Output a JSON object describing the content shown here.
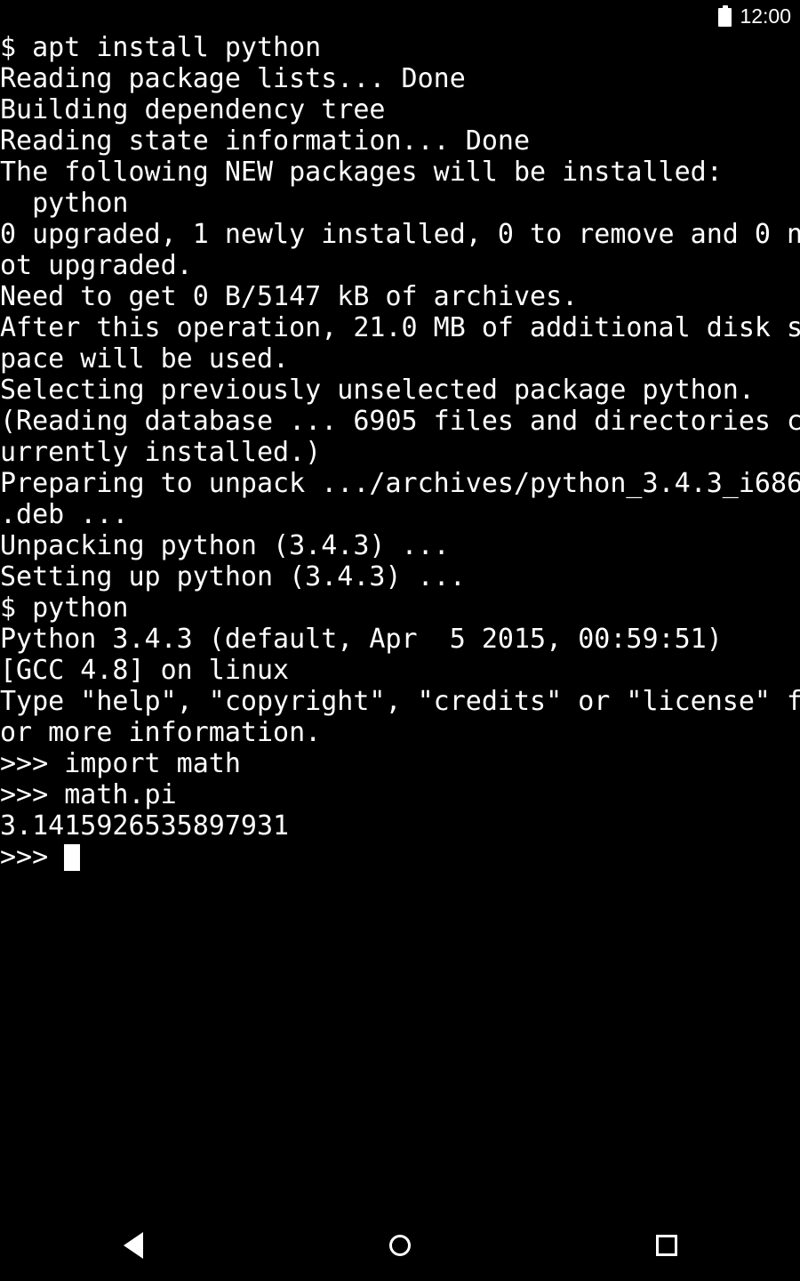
{
  "status_bar": {
    "battery_icon": "battery-full-icon",
    "time": "12:00"
  },
  "terminal": {
    "columns": 50,
    "foreground_color": "#ffffff",
    "background_color": "#000000",
    "cursor": "block",
    "lines": [
      "$ apt install python",
      "Reading package lists... Done",
      "Building dependency tree",
      "Reading state information... Done",
      "The following NEW packages will be installed:",
      "  python",
      "0 upgraded, 1 newly installed, 0 to remove and 0 n",
      "ot upgraded.",
      "Need to get 0 B/5147 kB of archives.",
      "After this operation, 21.0 MB of additional disk s",
      "pace will be used.",
      "Selecting previously unselected package python.",
      "(Reading database ... 6905 files and directories c",
      "urrently installed.)",
      "Preparing to unpack .../archives/python_3.4.3_i686",
      ".deb ...",
      "Unpacking python (3.4.3) ...",
      "Setting up python (3.4.3) ...",
      "$ python",
      "Python 3.4.3 (default, Apr  5 2015, 00:59:51)",
      "[GCC 4.8] on linux",
      "Type \"help\", \"copyright\", \"credits\" or \"license\" f",
      "or more information.",
      ">>> import math",
      ">>> math.pi",
      "3.1415926535897931"
    ],
    "prompt_line": ">>> "
  },
  "nav_bar": {
    "back_label": "Back",
    "home_label": "Home",
    "recents_label": "Recents"
  }
}
